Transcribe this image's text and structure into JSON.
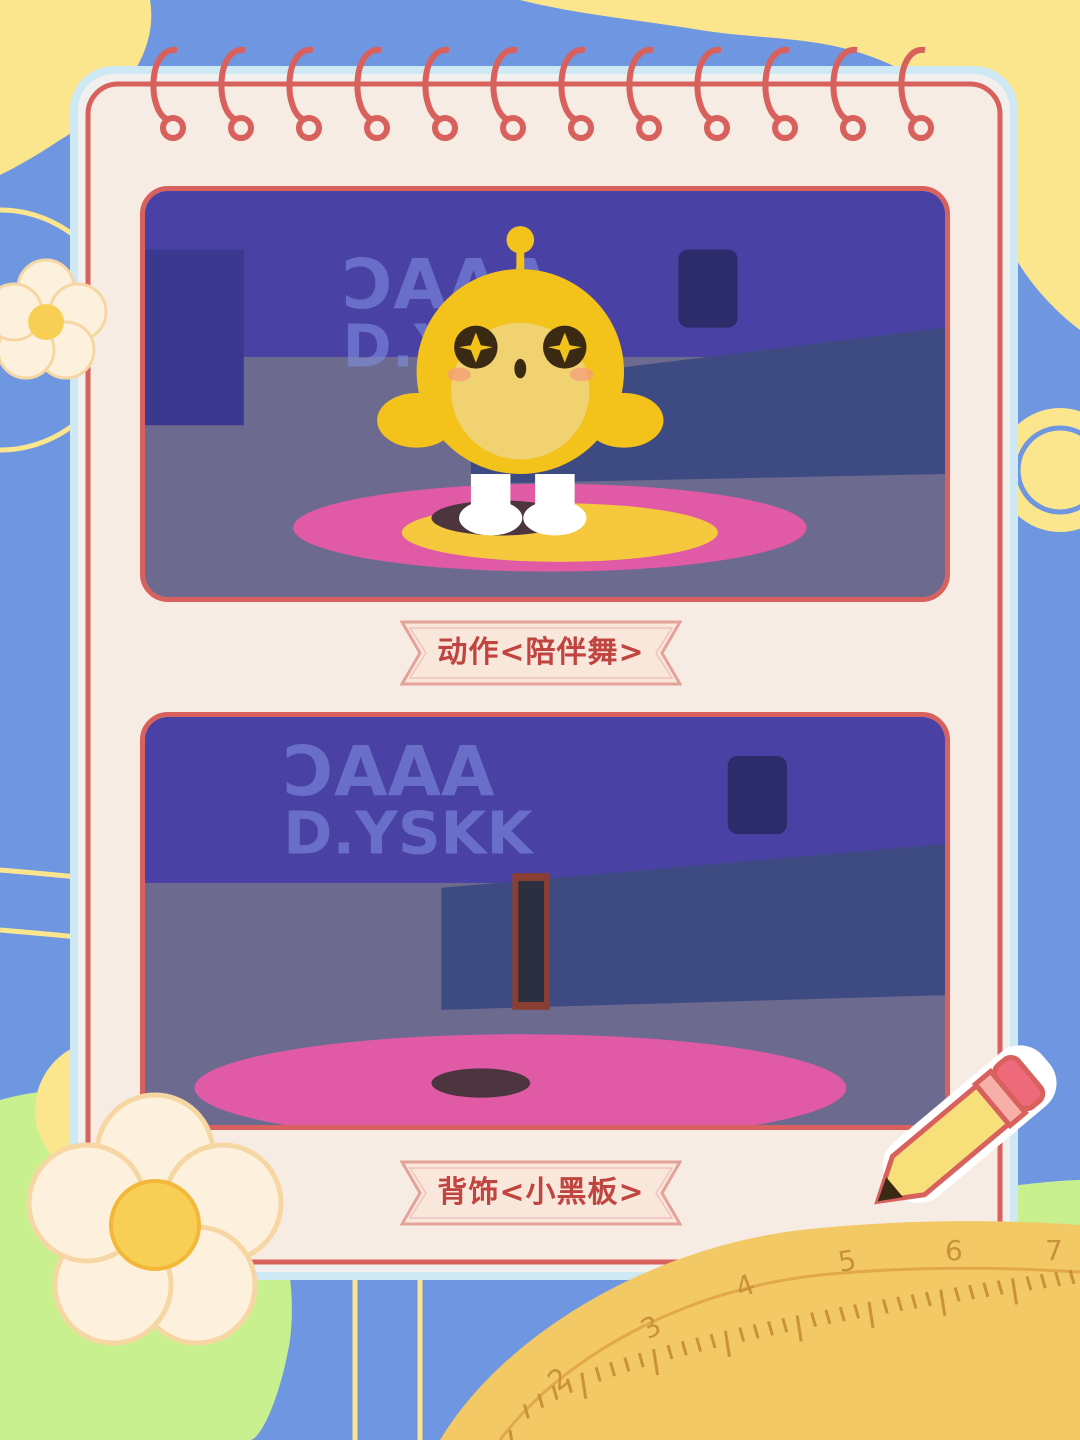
{
  "colors": {
    "background_blue": "#6f96e0",
    "cloud_yellow": "#fbe58d",
    "notebook_border": "#d8605d",
    "paper": "#f6ece4",
    "caption_text": "#c0443f",
    "mascot_yellow": "#f3c21b",
    "scene_purple": "#4f46a8"
  },
  "captions": {
    "first": "动作<陪伴舞>",
    "second": "背饰<小黑板>"
  },
  "ruler": {
    "ticks": [
      "2",
      "3",
      "4",
      "5",
      "6",
      "7"
    ]
  },
  "icons": [
    "flower-icon",
    "pencil-icon",
    "ruler-icon",
    "notebook-ring-icon"
  ]
}
